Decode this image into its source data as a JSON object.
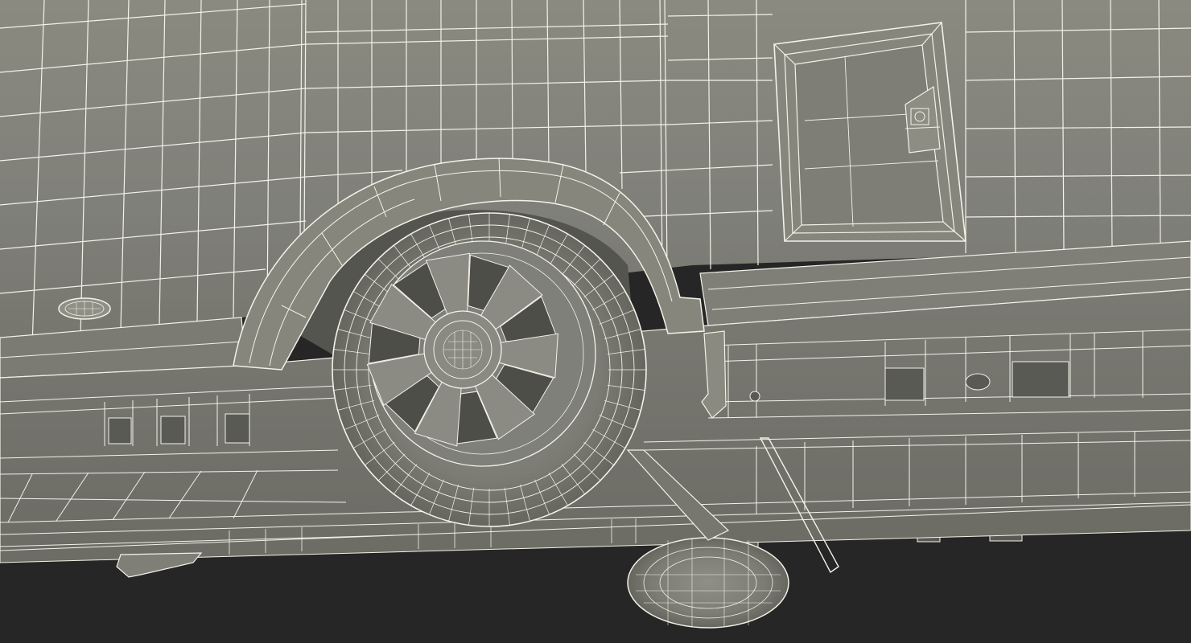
{
  "scene": {
    "subject": "trailer-underside-wireframe-render",
    "colors": {
      "background": "#262626",
      "body_shade": "#85857a",
      "body_dark": "#6c6c63",
      "wheel_well": "#55554f",
      "wire": "#f4f2e8",
      "wire_soft": "#d9d7cc"
    }
  }
}
